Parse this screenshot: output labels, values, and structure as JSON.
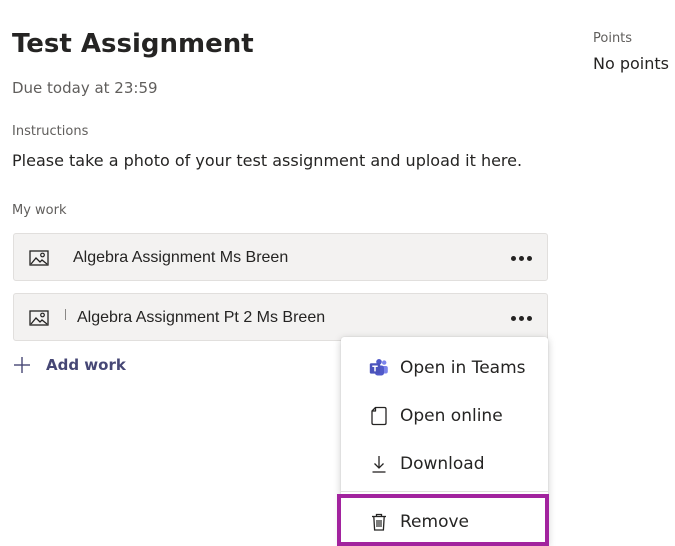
{
  "assignment": {
    "title": "Test Assignment",
    "due": "Due today at 23:59"
  },
  "points": {
    "label": "Points",
    "value": "No points"
  },
  "instructions": {
    "label": "Instructions",
    "text": "Please take a photo of your test assignment and upload it here."
  },
  "my_work": {
    "label": "My work",
    "items": [
      {
        "name": "Algebra Assignment Ms Breen",
        "icon": "image-file-icon"
      },
      {
        "name": "Algebra Assignment Pt 2 Ms Breen",
        "icon": "image-file-icon"
      }
    ],
    "add_label": "Add work"
  },
  "context_menu": {
    "items": [
      {
        "label": "Open in Teams",
        "icon": "teams-icon"
      },
      {
        "label": "Open online",
        "icon": "document-icon"
      },
      {
        "label": "Download",
        "icon": "download-icon"
      },
      {
        "label": "Remove",
        "icon": "trash-icon"
      }
    ]
  },
  "colors": {
    "accent": "#464775",
    "highlight_border": "#a2239e",
    "teams_brand": "#5b5fc7"
  }
}
